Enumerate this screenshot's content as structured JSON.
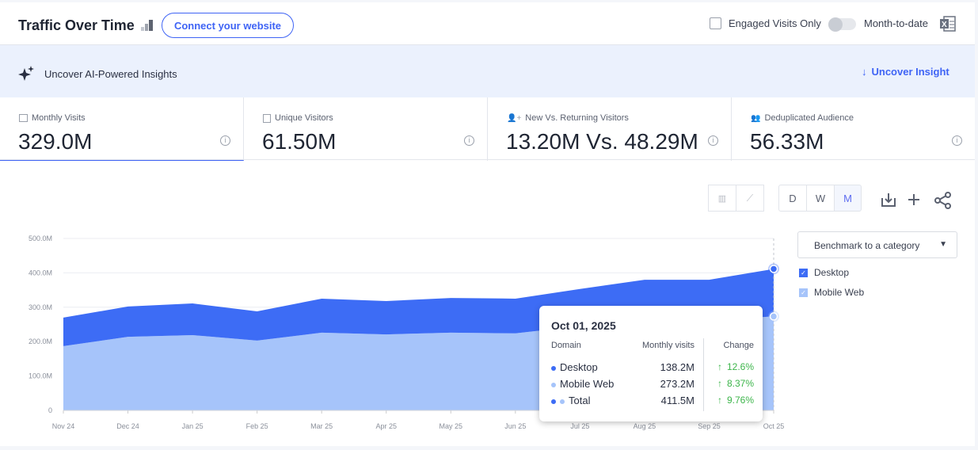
{
  "header": {
    "title": "Traffic Over Time",
    "connect_label": "Connect your website",
    "engaged_label": "Engaged Visits Only",
    "mtd_label": "Month-to-date",
    "excel_icon": "excel-icon"
  },
  "ai_bar": {
    "label": "Uncover AI-Powered Insights",
    "action": "Uncover Insight"
  },
  "kpis": [
    {
      "label": "Monthly Visits",
      "value": "329.0M",
      "icon": "calendar-icon"
    },
    {
      "label": "Unique Visitors",
      "value": "61.50M",
      "icon": "person-icon"
    },
    {
      "label": "New Vs. Returning Visitors",
      "value": "13.20M Vs. 48.29M",
      "icon": "person-plus-icon"
    },
    {
      "label": "Deduplicated Audience",
      "value": "56.33M",
      "icon": "people-icon"
    }
  ],
  "toolbar": {
    "granularity": [
      "D",
      "W",
      "M"
    ],
    "selected": "M"
  },
  "benchmark": {
    "label": "Benchmark to a category"
  },
  "legend": [
    {
      "label": "Desktop",
      "color": "#3d6cf5"
    },
    {
      "label": "Mobile Web",
      "color": "#a6c4fa"
    }
  ],
  "tooltip": {
    "date": "Oct 01, 2025",
    "col_domain": "Domain",
    "col_visits": "Monthly visits",
    "col_change": "Change",
    "rows": [
      {
        "name": "Desktop",
        "visits": "138.2M",
        "change": "12.6%"
      },
      {
        "name": "Mobile Web",
        "visits": "273.2M",
        "change": "8.37%"
      },
      {
        "name": "Total",
        "visits": "411.5M",
        "change": "9.76%"
      }
    ]
  },
  "chart_data": {
    "type": "area",
    "stacked": true,
    "categories": [
      "Nov 24",
      "Dec 24",
      "Jan 25",
      "Feb 25",
      "Mar 25",
      "Apr 25",
      "May 25",
      "Jun 25",
      "Jul 25",
      "Aug 25",
      "Sep 25",
      "Oct 25"
    ],
    "yticks": [
      "0",
      "100.0M",
      "200.0M",
      "300.0M",
      "400.0M",
      "500.0M"
    ],
    "ylim": [
      0,
      500
    ],
    "unit": "M",
    "grid": true,
    "legend_placement": "right",
    "series": [
      {
        "name": "Mobile Web",
        "color": "#a6c4fa",
        "values": [
          187,
          214,
          219,
          203,
          226,
          221,
          226,
          224,
          245,
          255,
          262,
          273.2
        ]
      },
      {
        "name": "Desktop",
        "color": "#3d6cf5",
        "values": [
          83,
          88,
          92,
          85,
          99,
          97,
          101,
          101,
          108,
          125,
          118,
          138.2
        ]
      }
    ]
  }
}
